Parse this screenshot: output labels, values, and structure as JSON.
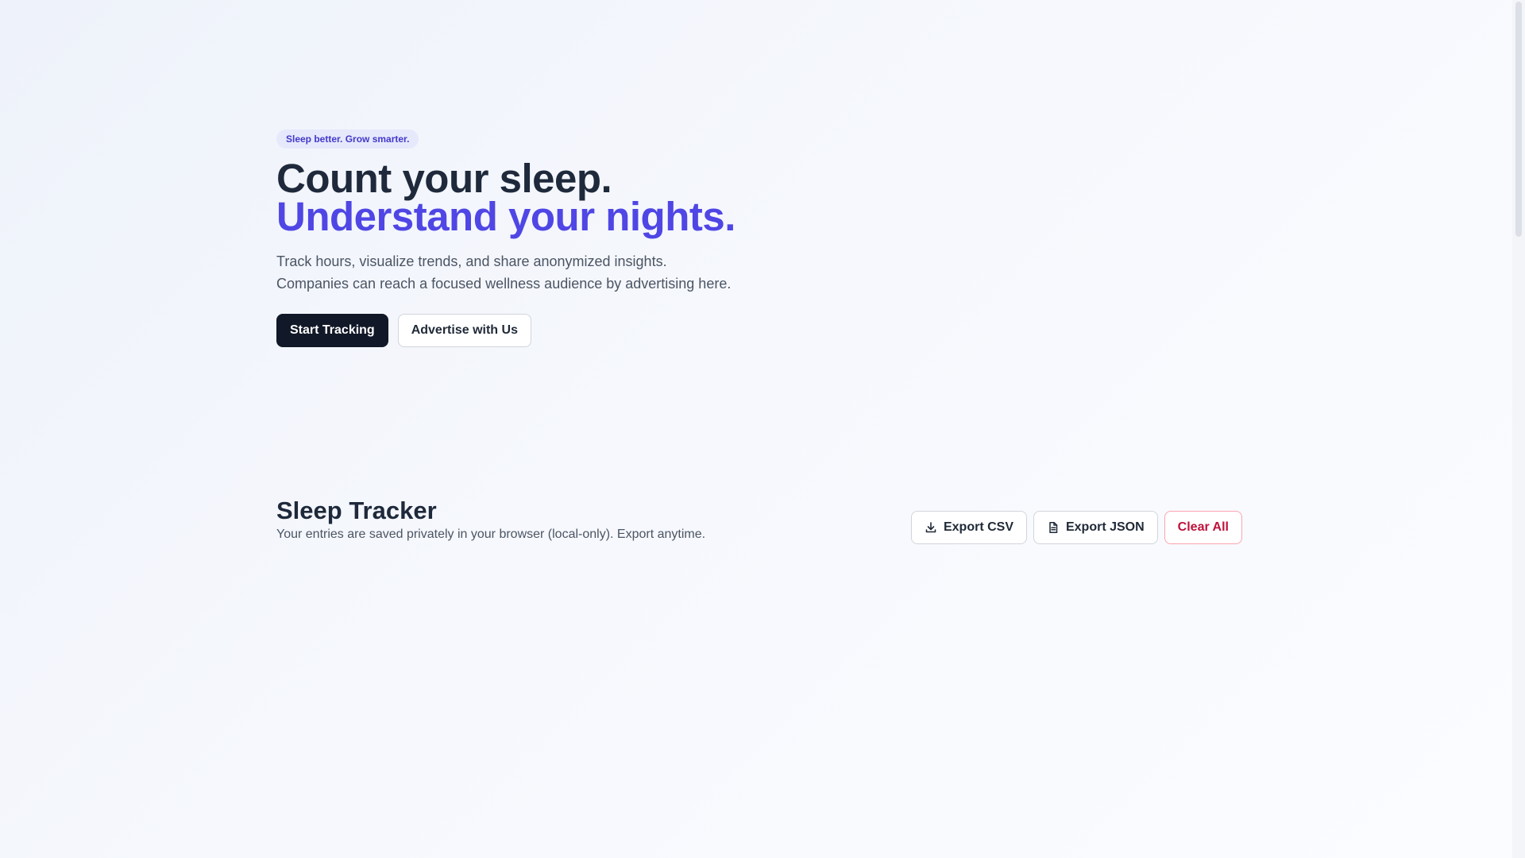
{
  "hero": {
    "badge": "Sleep better. Grow smarter.",
    "title_line1": "Count your sleep.",
    "title_line2": "Understand your nights.",
    "description": "Track hours, visualize trends, and share anonymized insights. Companies can reach a focused wellness audience by advertising here.",
    "primary_button": "Start Tracking",
    "secondary_button": "Advertise with Us"
  },
  "tracker": {
    "title": "Sleep Tracker",
    "subtitle": "Your entries are saved privately in your browser (local-only). Export anytime.",
    "export_csv": "Export CSV",
    "export_json": "Export JSON",
    "clear_all": "Clear All",
    "icons": {
      "export_csv": "download-icon",
      "export_json": "document-icon"
    }
  },
  "colors": {
    "accent": "#4f46e5",
    "primary_button_bg": "#111827",
    "danger": "#be123c"
  }
}
